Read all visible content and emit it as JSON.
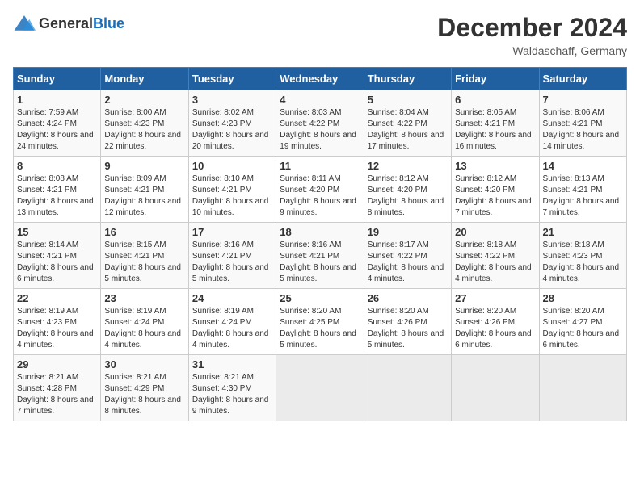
{
  "logo": {
    "general": "General",
    "blue": "Blue"
  },
  "title": "December 2024",
  "subtitle": "Waldaschaff, Germany",
  "days_of_week": [
    "Sunday",
    "Monday",
    "Tuesday",
    "Wednesday",
    "Thursday",
    "Friday",
    "Saturday"
  ],
  "weeks": [
    [
      {
        "day": "1",
        "sunrise": "7:59 AM",
        "sunset": "4:24 PM",
        "daylight": "8 hours and 24 minutes."
      },
      {
        "day": "2",
        "sunrise": "8:00 AM",
        "sunset": "4:23 PM",
        "daylight": "8 hours and 22 minutes."
      },
      {
        "day": "3",
        "sunrise": "8:02 AM",
        "sunset": "4:23 PM",
        "daylight": "8 hours and 20 minutes."
      },
      {
        "day": "4",
        "sunrise": "8:03 AM",
        "sunset": "4:22 PM",
        "daylight": "8 hours and 19 minutes."
      },
      {
        "day": "5",
        "sunrise": "8:04 AM",
        "sunset": "4:22 PM",
        "daylight": "8 hours and 17 minutes."
      },
      {
        "day": "6",
        "sunrise": "8:05 AM",
        "sunset": "4:21 PM",
        "daylight": "8 hours and 16 minutes."
      },
      {
        "day": "7",
        "sunrise": "8:06 AM",
        "sunset": "4:21 PM",
        "daylight": "8 hours and 14 minutes."
      }
    ],
    [
      {
        "day": "8",
        "sunrise": "8:08 AM",
        "sunset": "4:21 PM",
        "daylight": "8 hours and 13 minutes."
      },
      {
        "day": "9",
        "sunrise": "8:09 AM",
        "sunset": "4:21 PM",
        "daylight": "8 hours and 12 minutes."
      },
      {
        "day": "10",
        "sunrise": "8:10 AM",
        "sunset": "4:21 PM",
        "daylight": "8 hours and 10 minutes."
      },
      {
        "day": "11",
        "sunrise": "8:11 AM",
        "sunset": "4:20 PM",
        "daylight": "8 hours and 9 minutes."
      },
      {
        "day": "12",
        "sunrise": "8:12 AM",
        "sunset": "4:20 PM",
        "daylight": "8 hours and 8 minutes."
      },
      {
        "day": "13",
        "sunrise": "8:12 AM",
        "sunset": "4:20 PM",
        "daylight": "8 hours and 7 minutes."
      },
      {
        "day": "14",
        "sunrise": "8:13 AM",
        "sunset": "4:21 PM",
        "daylight": "8 hours and 7 minutes."
      }
    ],
    [
      {
        "day": "15",
        "sunrise": "8:14 AM",
        "sunset": "4:21 PM",
        "daylight": "8 hours and 6 minutes."
      },
      {
        "day": "16",
        "sunrise": "8:15 AM",
        "sunset": "4:21 PM",
        "daylight": "8 hours and 5 minutes."
      },
      {
        "day": "17",
        "sunrise": "8:16 AM",
        "sunset": "4:21 PM",
        "daylight": "8 hours and 5 minutes."
      },
      {
        "day": "18",
        "sunrise": "8:16 AM",
        "sunset": "4:21 PM",
        "daylight": "8 hours and 5 minutes."
      },
      {
        "day": "19",
        "sunrise": "8:17 AM",
        "sunset": "4:22 PM",
        "daylight": "8 hours and 4 minutes."
      },
      {
        "day": "20",
        "sunrise": "8:18 AM",
        "sunset": "4:22 PM",
        "daylight": "8 hours and 4 minutes."
      },
      {
        "day": "21",
        "sunrise": "8:18 AM",
        "sunset": "4:23 PM",
        "daylight": "8 hours and 4 minutes."
      }
    ],
    [
      {
        "day": "22",
        "sunrise": "8:19 AM",
        "sunset": "4:23 PM",
        "daylight": "8 hours and 4 minutes."
      },
      {
        "day": "23",
        "sunrise": "8:19 AM",
        "sunset": "4:24 PM",
        "daylight": "8 hours and 4 minutes."
      },
      {
        "day": "24",
        "sunrise": "8:19 AM",
        "sunset": "4:24 PM",
        "daylight": "8 hours and 4 minutes."
      },
      {
        "day": "25",
        "sunrise": "8:20 AM",
        "sunset": "4:25 PM",
        "daylight": "8 hours and 5 minutes."
      },
      {
        "day": "26",
        "sunrise": "8:20 AM",
        "sunset": "4:26 PM",
        "daylight": "8 hours and 5 minutes."
      },
      {
        "day": "27",
        "sunrise": "8:20 AM",
        "sunset": "4:26 PM",
        "daylight": "8 hours and 6 minutes."
      },
      {
        "day": "28",
        "sunrise": "8:20 AM",
        "sunset": "4:27 PM",
        "daylight": "8 hours and 6 minutes."
      }
    ],
    [
      {
        "day": "29",
        "sunrise": "8:21 AM",
        "sunset": "4:28 PM",
        "daylight": "8 hours and 7 minutes."
      },
      {
        "day": "30",
        "sunrise": "8:21 AM",
        "sunset": "4:29 PM",
        "daylight": "8 hours and 8 minutes."
      },
      {
        "day": "31",
        "sunrise": "8:21 AM",
        "sunset": "4:30 PM",
        "daylight": "8 hours and 9 minutes."
      },
      null,
      null,
      null,
      null
    ]
  ],
  "labels": {
    "sunrise": "Sunrise:",
    "sunset": "Sunset:",
    "daylight": "Daylight:"
  }
}
